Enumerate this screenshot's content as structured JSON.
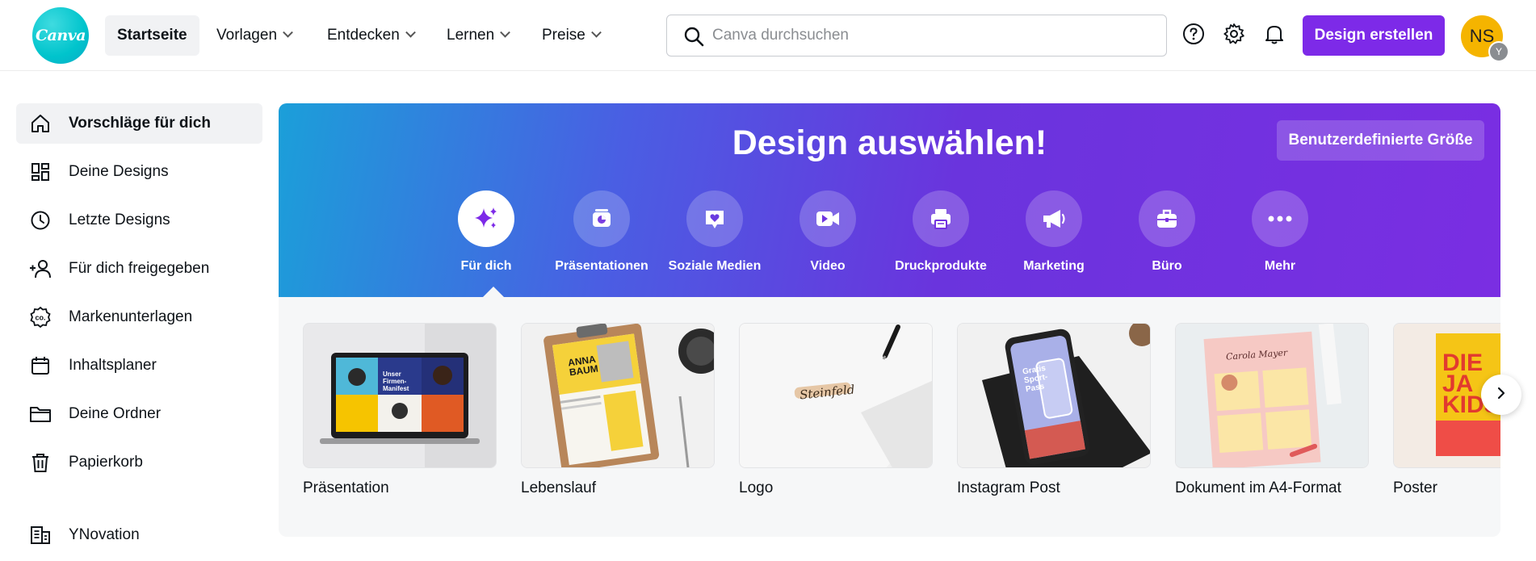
{
  "logo": {
    "text": "Canva"
  },
  "nav": {
    "home": "Startseite",
    "items": [
      "Vorlagen",
      "Entdecken",
      "Lernen",
      "Preise"
    ]
  },
  "search": {
    "placeholder": "Canva durchsuchen"
  },
  "header": {
    "create_label": "Design erstellen"
  },
  "avatar": {
    "initials": "NS",
    "sub": "Y"
  },
  "sidebar": {
    "items": [
      {
        "label": "Vorschläge für dich",
        "icon": "home-icon"
      },
      {
        "label": "Deine Designs",
        "icon": "grid-icon"
      },
      {
        "label": "Letzte Designs",
        "icon": "clock-icon"
      },
      {
        "label": "Für dich freigegeben",
        "icon": "shared-users-icon"
      },
      {
        "label": "Markenunterlagen",
        "icon": "brand-icon"
      },
      {
        "label": "Inhaltsplaner",
        "icon": "calendar-icon"
      },
      {
        "label": "Deine Ordner",
        "icon": "folder-icon"
      },
      {
        "label": "Papierkorb",
        "icon": "trash-icon"
      }
    ],
    "team": {
      "label": "YNovation",
      "icon": "building-icon"
    }
  },
  "banner": {
    "title": "Design auswählen!",
    "custom_size": "Benutzerdefinierte Größe",
    "categories": [
      {
        "label": "Für dich",
        "icon": "sparkle-icon"
      },
      {
        "label": "Präsentationen",
        "icon": "presentation-icon"
      },
      {
        "label": "Soziale Medien",
        "icon": "heart-chat-icon"
      },
      {
        "label": "Video",
        "icon": "video-icon"
      },
      {
        "label": "Druckprodukte",
        "icon": "printer-icon"
      },
      {
        "label": "Marketing",
        "icon": "megaphone-icon"
      },
      {
        "label": "Büro",
        "icon": "briefcase-icon"
      },
      {
        "label": "Mehr",
        "icon": "more-icon"
      }
    ]
  },
  "templates": [
    {
      "label": "Präsentation",
      "thumb_text": [
        "Unser",
        "Firmen-",
        "Manifest"
      ]
    },
    {
      "label": "Lebenslauf",
      "thumb_text": [
        "ANNA",
        "BAUM"
      ]
    },
    {
      "label": "Logo",
      "thumb_text": [
        "Steinfeld"
      ]
    },
    {
      "label": "Instagram Post",
      "thumb_text": [
        "Gratis",
        "Sport-",
        "Pass"
      ]
    },
    {
      "label": "Dokument im A4-Format",
      "thumb_text": [
        "Carola Mayer"
      ]
    },
    {
      "label": "Poster",
      "thumb_text": [
        "DIE",
        "JA",
        "KIDS"
      ]
    }
  ],
  "colors": {
    "accent": "#7d2ae8",
    "logo": "#00c4cc",
    "avatar": "#f5b400"
  }
}
